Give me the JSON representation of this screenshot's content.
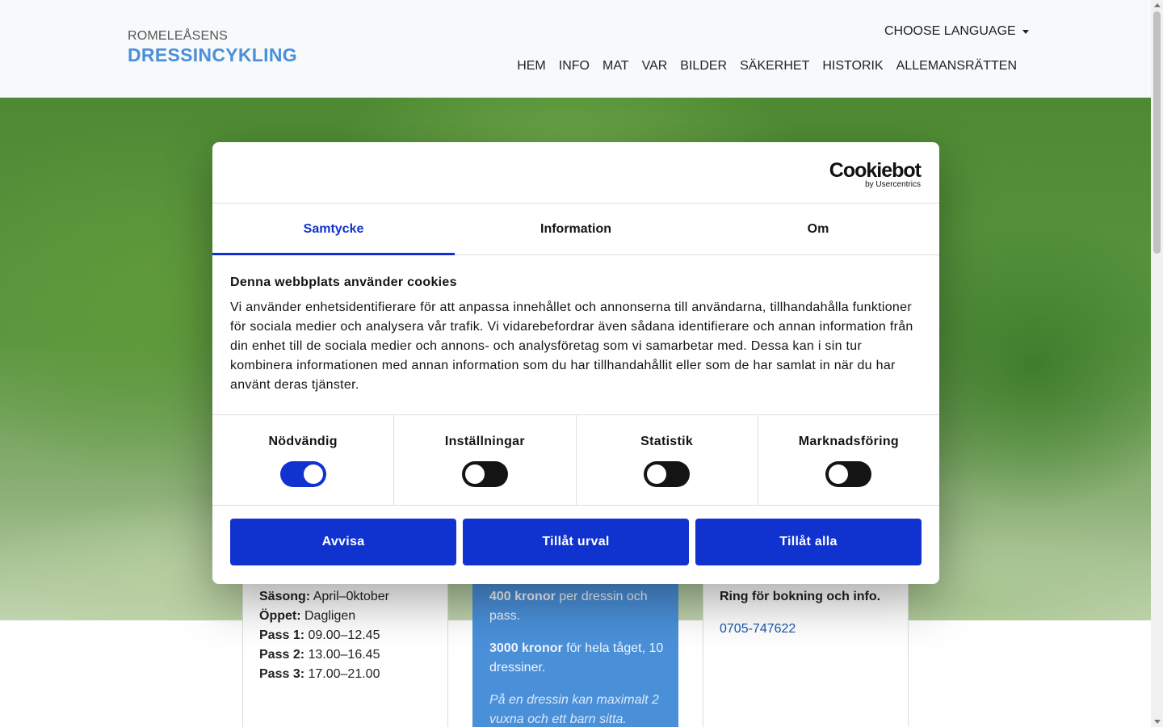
{
  "header": {
    "brand_top": "ROMELEÅSENS",
    "brand_main": "DRESSINCYKLING",
    "language_label": "CHOOSE LANGUAGE",
    "nav": [
      "HEM",
      "INFO",
      "MAT",
      "VAR",
      "BILDER",
      "SÄKERHET",
      "HISTORIK",
      "ALLEMANSRÄTTEN"
    ]
  },
  "cards": {
    "schedule": [
      {
        "label": "Säsong:",
        "value": " April–0ktober"
      },
      {
        "label": "Öppet:",
        "value": " Dagligen"
      },
      {
        "label": "Pass 1:",
        "value": " 09.00–12.45"
      },
      {
        "label": "Pass 2:",
        "value": " 13.00–16.45"
      },
      {
        "label": "Pass 3:",
        "value": " 17.00–21.00"
      }
    ],
    "price": {
      "p1_bold": "400 kronor",
      "p1_rest": " per dressin och pass.",
      "p2_bold": "3000 kronor",
      "p2_rest": " för hela tåget, 10 dressiner.",
      "note": "På en dressin kan maximalt 2 vuxna och ett barn sitta."
    },
    "booking": {
      "title": "Ring för bokning och info.",
      "phone": "0705-747622"
    }
  },
  "cookie_dialog": {
    "logo_main": "Cookiebot",
    "logo_sub": "by Usercentrics",
    "tabs": [
      "Samtycke",
      "Information",
      "Om"
    ],
    "active_tab": "Samtycke",
    "heading": "Denna webbplats använder cookies",
    "body": "Vi använder enhetsidentifierare för att anpassa innehållet och annonserna till användarna, tillhandahålla funktioner för sociala medier och analysera vår trafik. Vi vidarebefordrar även sådana identifierare och annan information från din enhet till de sociala medier och annons- och analysföretag som vi samarbetar med. Dessa kan i sin tur kombinera informationen med annan information som du har tillhandahållit eller som de har samlat in när du har använt deras tjänster.",
    "toggles": [
      {
        "label": "Nödvändig",
        "on": true
      },
      {
        "label": "Inställningar",
        "on": false
      },
      {
        "label": "Statistik",
        "on": false
      },
      {
        "label": "Marknadsföring",
        "on": false
      }
    ],
    "buttons": [
      "Avvisa",
      "Tillåt urval",
      "Tillåt alla"
    ],
    "accent_color": "#1032cf"
  }
}
